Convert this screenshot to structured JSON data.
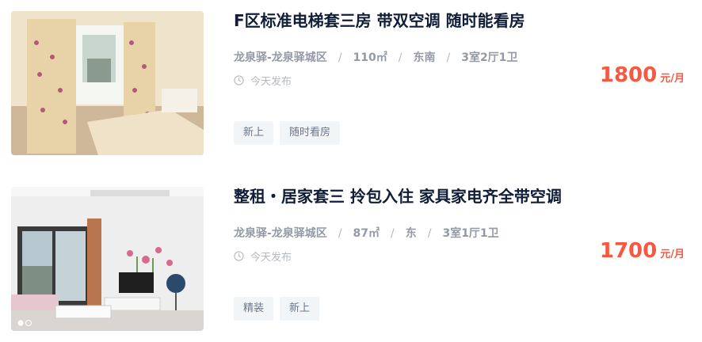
{
  "listings": [
    {
      "title": "F区标准电梯套三房 带双空调 随时能看房",
      "community": "龙泉驿-龙泉驿城区",
      "area": "110㎡",
      "orientation": "东南",
      "layout": "3室2厅1卫",
      "publish_time": "今天发布",
      "price": "1800",
      "price_unit": "元/月",
      "tags": [
        "新上",
        "随时看房"
      ]
    },
    {
      "title": "整租・居家套三 拎包入住 家具家电齐全带空调",
      "community": "龙泉驿-龙泉驿城区",
      "area": "87㎡",
      "orientation": "东",
      "layout": "3室1厅1卫",
      "publish_time": "今天发布",
      "price": "1700",
      "price_unit": "元/月",
      "tags": [
        "精装",
        "新上"
      ]
    }
  ],
  "separator": "/",
  "icons": {
    "time": "clock-icon"
  },
  "colors": {
    "price": "#fa5741",
    "title": "#101d37",
    "meta": "#9399a5",
    "tag_bg": "#f2f5f7"
  }
}
